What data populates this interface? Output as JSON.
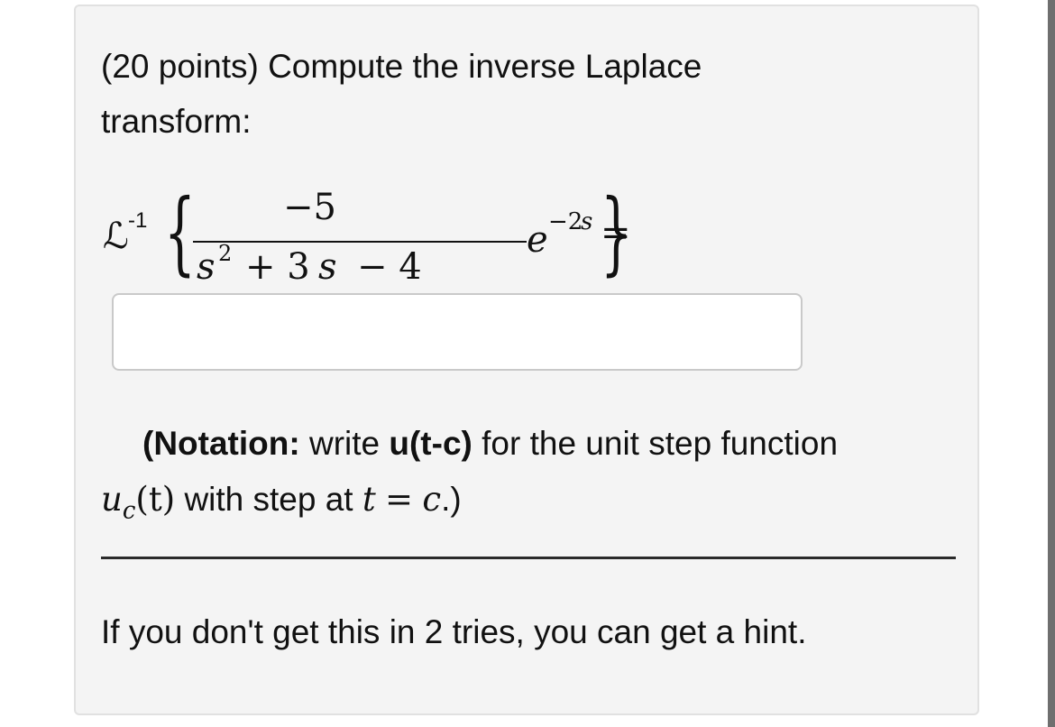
{
  "problem": {
    "line1": "(20 points) Compute the inverse Laplace",
    "line2": "transform:"
  },
  "formula": {
    "operator": "ℒ",
    "operator_sup": "-1",
    "left_brace": "{",
    "numerator": "−5",
    "denominator_s": "s",
    "denominator_sq": "2",
    "denominator_rest": "+ 3",
    "denominator_s2": "s",
    "denominator_minus4": "− 4",
    "exp_base": "e",
    "exp_power_num": "−2",
    "exp_power_var": "s",
    "right_brace": "}",
    "equals": "="
  },
  "answer": {
    "value": "",
    "placeholder": ""
  },
  "notation": {
    "open": "(",
    "label": "Notation:",
    "text1": "write",
    "code": "u(t-c)",
    "text2": "for the unit step function",
    "u": "u",
    "u_sub": "c",
    "u_arg": "(t)",
    "text3": "with step at",
    "t": "t",
    "eq": "=",
    "c": "c",
    "close": ".)"
  },
  "hint": {
    "text": "If you don't get this in 2 tries, you can get a hint."
  }
}
